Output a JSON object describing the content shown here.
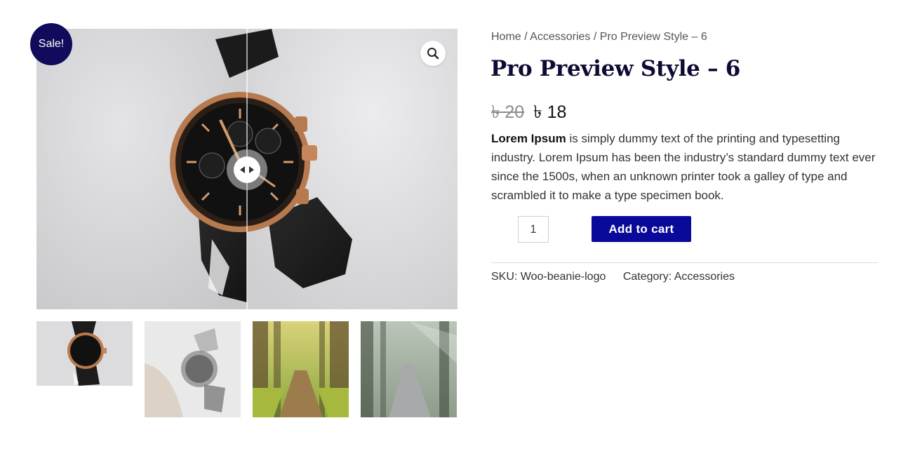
{
  "product": {
    "sale_badge": "Sale!",
    "breadcrumb": {
      "home": "Home",
      "separator": "/",
      "category": "Accessories",
      "current": "Pro Preview Style – 6"
    },
    "title": "Pro Preview Style – 6",
    "price": {
      "regular": "৳ 20",
      "sale": "৳ 18"
    },
    "description": {
      "lead": "Lorem Ipsum",
      "body": " is simply dummy text of the printing and typesetting industry. Lorem Ipsum has been the industry’s standard dummy text ever since the 1500s, when an unknown printer took a galley of type and scrambled it to make a type specimen book."
    },
    "quantity": "1",
    "add_to_cart_label": "Add to cart",
    "meta": {
      "sku_label": "SKU:",
      "sku_value": "Woo-beanie-logo",
      "category_label": "Category:",
      "category_value": "Accessories"
    }
  },
  "gallery": {
    "zoom_icon": "magnifier-icon",
    "compare_icon": "left-right-arrows-icon",
    "thumbnails": [
      "watch-black-leather",
      "watch-faded",
      "forest-path-autumn",
      "forest-road-misty"
    ]
  },
  "colors": {
    "badge": "#120a5a",
    "title": "#0d0b33",
    "button": "#0a0a9a"
  }
}
